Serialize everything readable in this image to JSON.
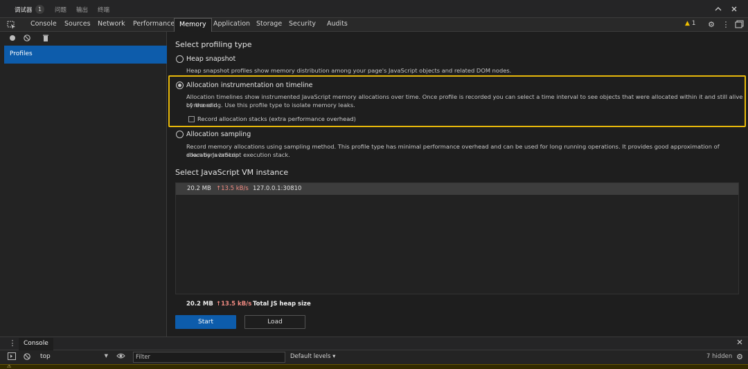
{
  "outer_tabs": {
    "debugger": "调试器",
    "debugger_badge": "1",
    "problems": "问题",
    "output": "输出",
    "terminal": "终端"
  },
  "window": {
    "collapse_icon": "chevron-up-icon",
    "close_icon": "close-icon"
  },
  "devtools_tabs": [
    "Console",
    "Sources",
    "Network",
    "Performance",
    "Memory",
    "Application",
    "Storage",
    "Security",
    "Audits"
  ],
  "active_tab": "Memory",
  "toolbar": {
    "warning_count": "1",
    "warning_color": "#f0c000"
  },
  "sidebar": {
    "profiles_label": "Profiles"
  },
  "profiling": {
    "title": "Select profiling type",
    "options": [
      {
        "label": "Heap snapshot",
        "description": "Heap snapshot profiles show memory distribution among your page's JavaScript objects and related DOM nodes."
      },
      {
        "label": "Allocation instrumentation on timeline",
        "description_line1": "Allocation timelines show instrumented JavaScript memory allocations over time. Once profile is recorded you can select a time interval to see objects that were allocated within it and still alive by the end",
        "description_line2": "of recording. Use this profile type to isolate memory leaks.",
        "checkbox_label": "Record allocation stacks (extra performance overhead)"
      },
      {
        "label": "Allocation sampling",
        "description_line1": "Record memory allocations using sampling method. This profile type has minimal performance overhead and can be used for long running operations. It provides good approximation of allocations broken",
        "description_line2": "down by JavaScript execution stack."
      }
    ]
  },
  "vm": {
    "title": "Select JavaScript VM instance",
    "instances": [
      {
        "size": "20.2 MB",
        "rate": "↑13.5 kB/s",
        "address": "127.0.0.1:30810"
      }
    ]
  },
  "summary": {
    "size": "20.2 MB",
    "rate": "↑13.5 kB/s",
    "label": "Total JS heap size"
  },
  "buttons": {
    "start": "Start",
    "load": "Load"
  },
  "drawer": {
    "tab": "Console",
    "context": "top",
    "filter_placeholder": "Filter",
    "levels": "Default levels ▾",
    "hidden": "7 hidden"
  },
  "colors": {
    "accent": "#0d5cab",
    "highlight": "#e8b90a",
    "rate": "#f28b82"
  }
}
